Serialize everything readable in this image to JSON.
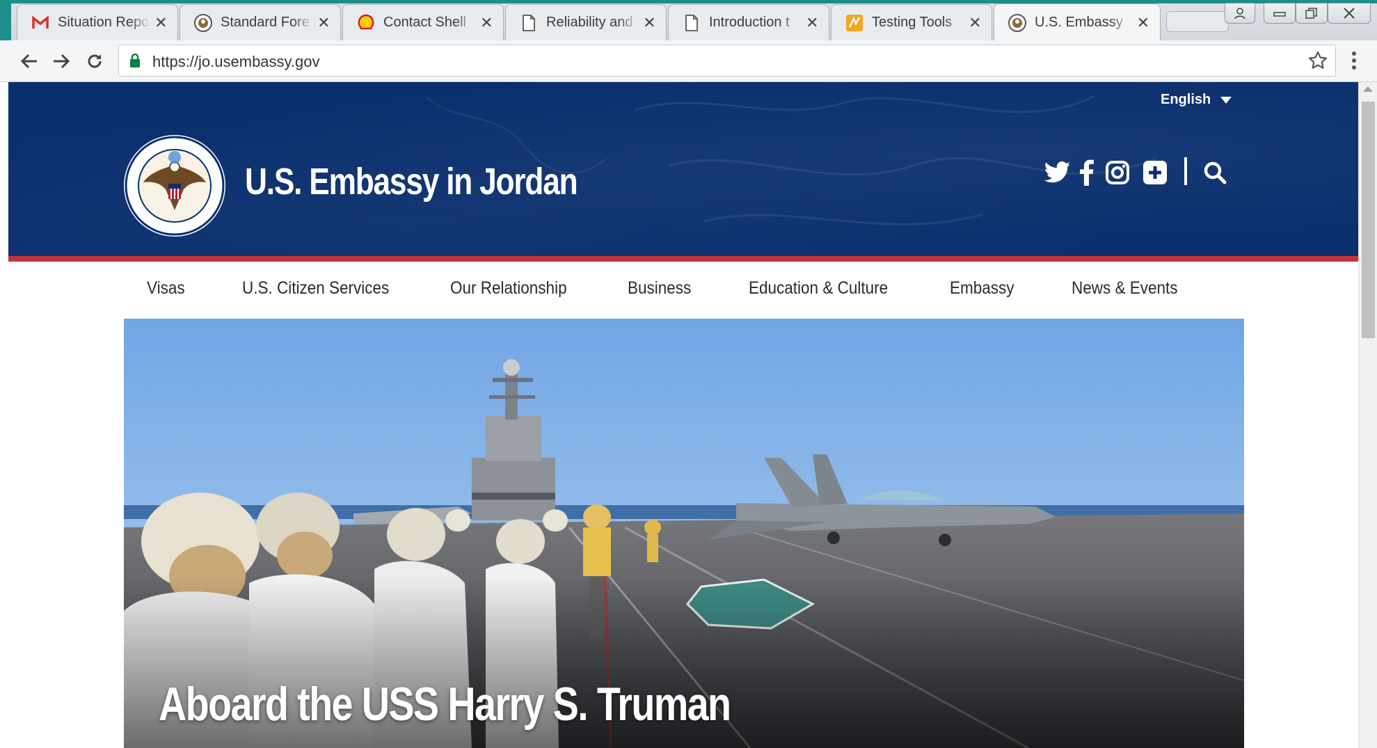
{
  "browser": {
    "tabs": [
      {
        "title": "Situation Repo",
        "icon": "gmail-icon",
        "active": false
      },
      {
        "title": "Standard Fore",
        "icon": "state-dept-seal-icon",
        "active": false
      },
      {
        "title": "Contact Shell",
        "icon": "shell-icon",
        "active": false
      },
      {
        "title": "Reliability and",
        "icon": "page-icon",
        "active": false
      },
      {
        "title": "Introduction t",
        "icon": "page-icon",
        "active": false
      },
      {
        "title": "Testing Tools",
        "icon": "testing-tools-icon",
        "active": false
      },
      {
        "title": "U.S. Embassy",
        "icon": "state-dept-seal-icon",
        "active": true
      }
    ],
    "url": "https://jo.usembassy.gov"
  },
  "site": {
    "language": "English",
    "title": "U.S. Embassy in Jordan",
    "social_icons": [
      "twitter-icon",
      "facebook-icon",
      "instagram-icon",
      "plus-icon",
      "search-icon"
    ],
    "nav": [
      "Visas",
      "U.S. Citizen Services",
      "Our Relationship",
      "Business",
      "Education & Culture",
      "Embassy",
      "News & Events"
    ],
    "hero_caption": "Aboard the USS Harry S. Truman"
  },
  "colors": {
    "header_blue": "#0a2f6d",
    "accent_red": "#c8333a",
    "chrome_teal": "#1c8e8c"
  }
}
